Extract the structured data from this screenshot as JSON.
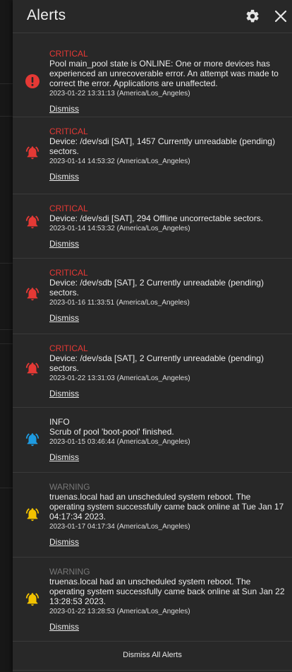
{
  "header": {
    "title": "Alerts"
  },
  "alerts": [
    {
      "level": "CRITICAL",
      "message": "Pool main_pool state is ONLINE: One or more devices has experienced an unrecoverable error. An attempt was made to correct the error. Applications are unaffected.",
      "timestamp": "2023-01-22 13:31:13 (America/Los_Angeles)",
      "dismiss": "Dismiss",
      "icon": "error-icon"
    },
    {
      "level": "CRITICAL",
      "message": "Device: /dev/sdi [SAT], 1457 Currently unreadable (pending) sectors.",
      "timestamp": "2023-01-14 14:53:32 (America/Los_Angeles)",
      "dismiss": "Dismiss",
      "icon": "bell-ring-icon"
    },
    {
      "level": "CRITICAL",
      "message": "Device: /dev/sdi [SAT], 294 Offline uncorrectable sectors.",
      "timestamp": "2023-01-14 14:53:32 (America/Los_Angeles)",
      "dismiss": "Dismiss",
      "icon": "bell-ring-icon"
    },
    {
      "level": "CRITICAL",
      "message": "Device: /dev/sdb [SAT], 2 Currently unreadable (pending) sectors.",
      "timestamp": "2023-01-16 11:33:51 (America/Los_Angeles)",
      "dismiss": "Dismiss",
      "icon": "bell-ring-icon"
    },
    {
      "level": "CRITICAL",
      "message": "Device: /dev/sda [SAT], 2 Currently unreadable (pending) sectors.",
      "timestamp": "2023-01-22 13:31:03 (America/Los_Angeles)",
      "dismiss": "Dismiss",
      "icon": "bell-ring-icon"
    },
    {
      "level": "INFO",
      "message": "Scrub of pool 'boot-pool' finished.",
      "timestamp": "2023-01-15 03:46:44 (America/Los_Angeles)",
      "dismiss": "Dismiss",
      "icon": "bell-ring-icon"
    },
    {
      "level": "WARNING",
      "message": "truenas.local had an unscheduled system reboot. The operating system successfully came back online at Tue Jan 17 04:17:34 2023.",
      "timestamp": "2023-01-17 04:17:34 (America/Los_Angeles)",
      "dismiss": "Dismiss",
      "icon": "bell-ring-icon"
    },
    {
      "level": "WARNING",
      "message": "truenas.local had an unscheduled system reboot. The operating system successfully came back online at Sun Jan 22 13:28:53 2023.",
      "timestamp": "2023-01-22 13:28:53 (America/Los_Angeles)",
      "dismiss": "Dismiss",
      "icon": "bell-ring-icon"
    }
  ],
  "footer": {
    "dismiss_all": "Dismiss All Alerts"
  },
  "colors": {
    "critical": "#e53935",
    "info": "#1e9be0",
    "warning": "#f2c200",
    "panel": "#282828"
  }
}
